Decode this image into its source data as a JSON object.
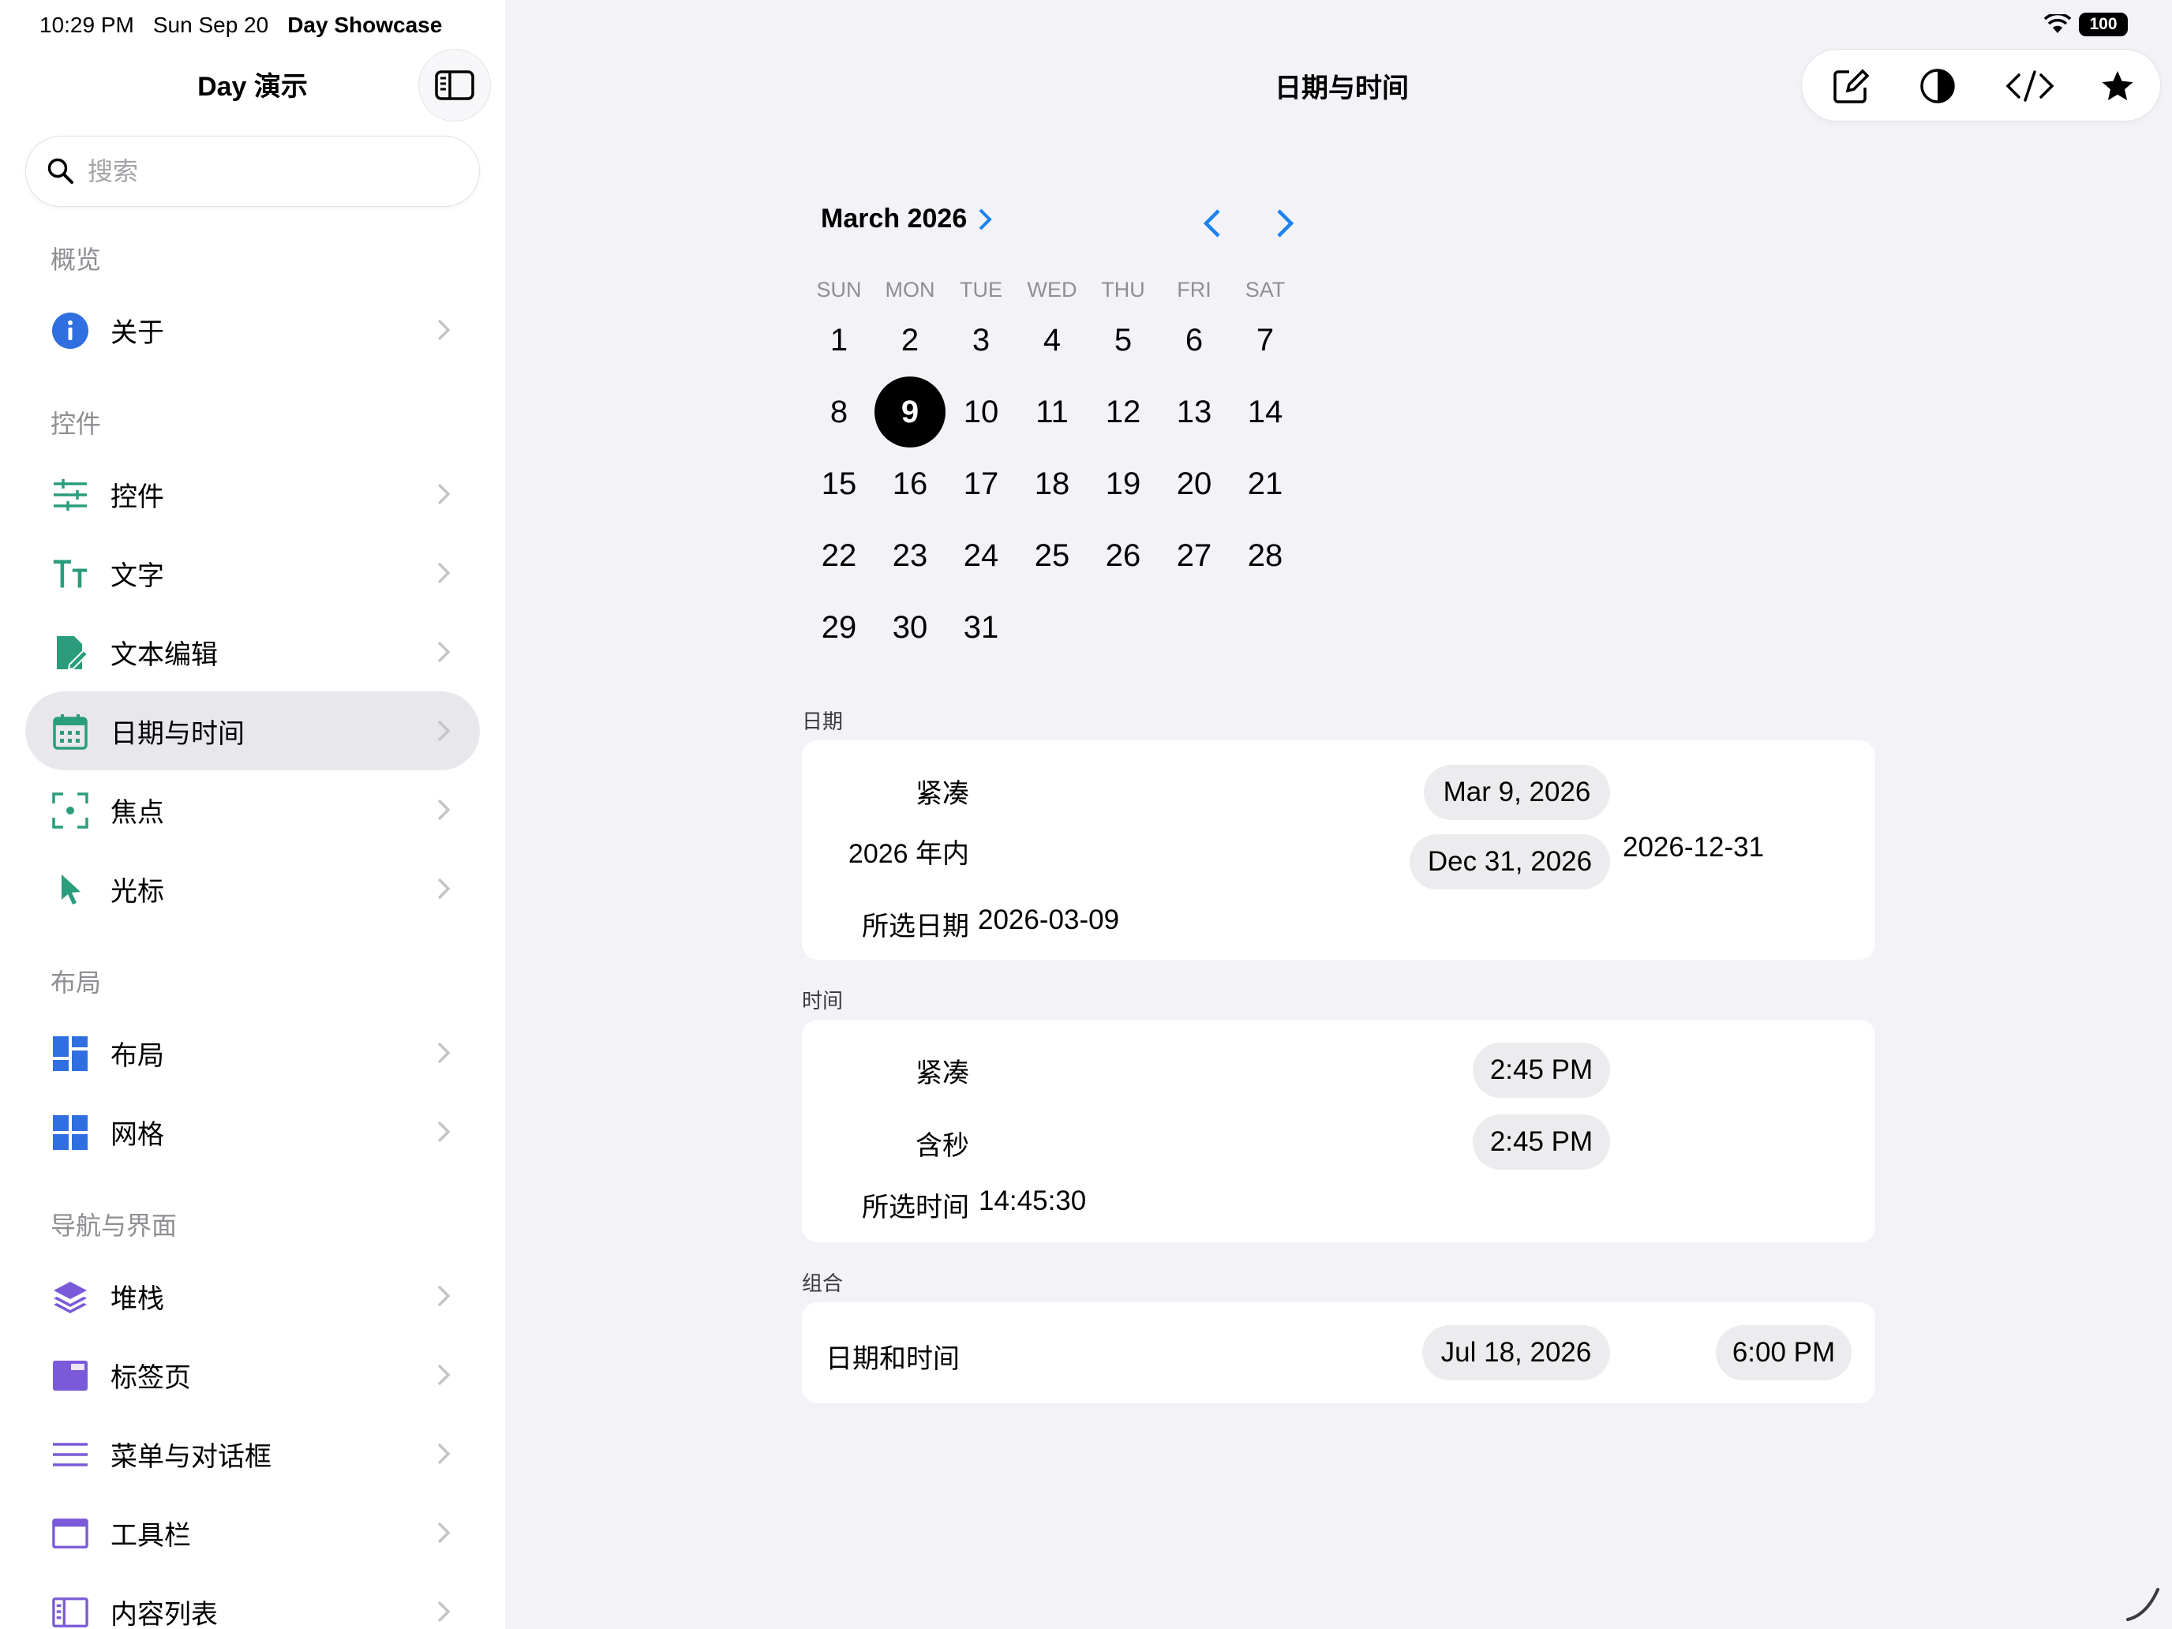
{
  "status_bar": {
    "time": "10:29 PM",
    "date": "Sun Sep 20",
    "app_name": "Day Showcase",
    "battery": "100"
  },
  "sidebar": {
    "title": "Day 演示",
    "search_placeholder": "搜索",
    "sections": [
      {
        "header": "概览",
        "items": [
          {
            "label": "关于",
            "icon": "info-icon",
            "color": "#2f6fe0"
          }
        ]
      },
      {
        "header": "控件",
        "items": [
          {
            "label": "控件",
            "icon": "sliders-icon",
            "color": "#2a9d7c"
          },
          {
            "label": "文字",
            "icon": "text-size-icon",
            "color": "#2a9d7c"
          },
          {
            "label": "文本编辑",
            "icon": "document-edit-icon",
            "color": "#2a9d7c"
          },
          {
            "label": "日期与时间",
            "icon": "calendar-icon",
            "color": "#2a9d7c",
            "selected": true
          },
          {
            "label": "焦点",
            "icon": "focus-icon",
            "color": "#2a9d7c"
          },
          {
            "label": "光标",
            "icon": "cursor-icon",
            "color": "#2a9d7c"
          }
        ]
      },
      {
        "header": "布局",
        "items": [
          {
            "label": "布局",
            "icon": "layout-icon",
            "color": "#2f6fe0"
          },
          {
            "label": "网格",
            "icon": "grid-icon",
            "color": "#2f6fe0"
          }
        ]
      },
      {
        "header": "导航与界面",
        "items": [
          {
            "label": "堆栈",
            "icon": "stack-icon",
            "color": "#7a5ad8"
          },
          {
            "label": "标签页",
            "icon": "tabs-icon",
            "color": "#7a5ad8"
          },
          {
            "label": "菜单与对话框",
            "icon": "menu-icon",
            "color": "#7a5ad8"
          },
          {
            "label": "工具栏",
            "icon": "toolbar-icon",
            "color": "#7a5ad8"
          },
          {
            "label": "内容列表",
            "icon": "content-list-icon",
            "color": "#7a5ad8"
          }
        ]
      }
    ]
  },
  "main": {
    "title": "日期与时间",
    "toolbar_icons": [
      "compose-icon",
      "contrast-icon",
      "code-icon",
      "star-icon"
    ],
    "calendar": {
      "month_label": "March 2026",
      "weekdays": [
        "SUN",
        "MON",
        "TUE",
        "WED",
        "THU",
        "FRI",
        "SAT"
      ],
      "first_weekday_index": 0,
      "days_in_month": 31,
      "selected_day": 9,
      "accent": "#1a82f0"
    },
    "date_section": {
      "label": "日期",
      "compact_label": "紧凑",
      "compact_value": "Mar 9, 2026",
      "in_year_label": "2026 年内",
      "in_year_value": "Dec 31, 2026",
      "in_year_text": "2026-12-31",
      "selected_label": "所选日期",
      "selected_value": "2026-03-09"
    },
    "time_section": {
      "label": "时间",
      "compact_label": "紧凑",
      "compact_value": "2:45 PM",
      "seconds_label": "含秒",
      "seconds_value": "2:45 PM",
      "selected_label": "所选时间",
      "selected_value": "14:45:30"
    },
    "combined_section": {
      "label": "组合",
      "row_label": "日期和时间",
      "date_value": "Jul 18, 2026",
      "time_value": "6:00 PM"
    }
  }
}
